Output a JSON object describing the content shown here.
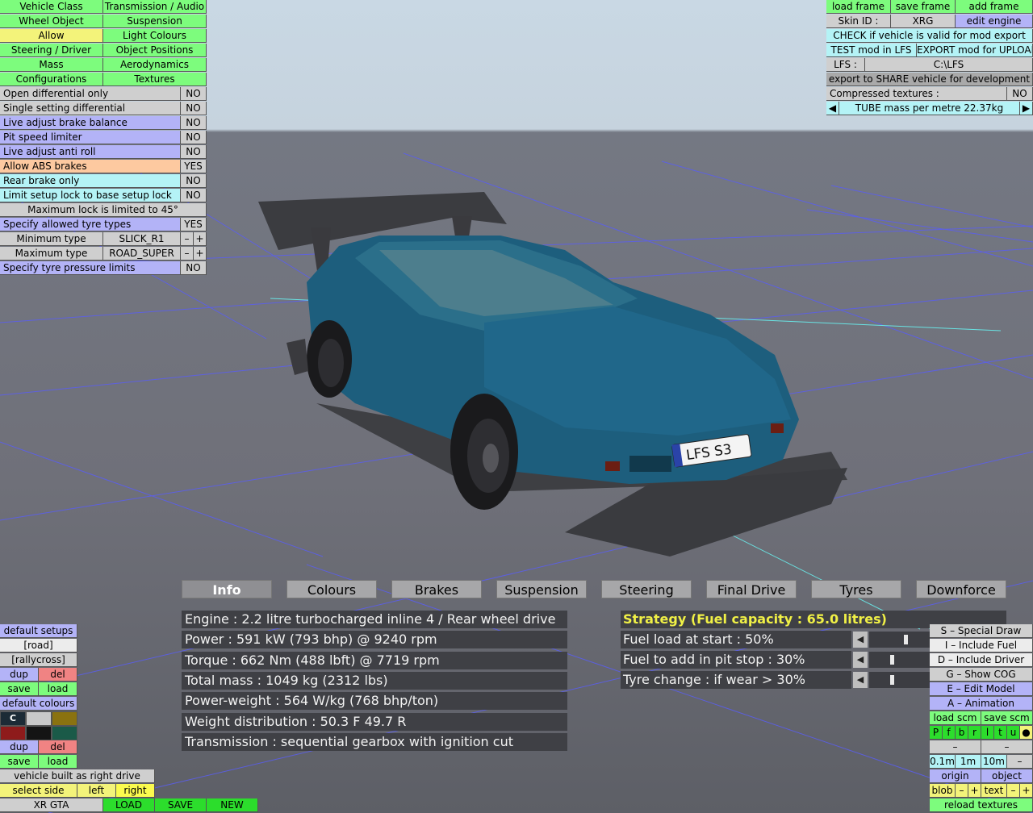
{
  "colors": {
    "accent_green": "#7dfc7d",
    "accent_yellow": "#f3f37a",
    "accent_purple": "#b3b3f7",
    "accent_cyan": "#b4f3f6",
    "car_blue": "#1d5e7d",
    "grid_line": "#5a5ef2"
  },
  "top_menu": [
    {
      "label": "Vehicle Class"
    },
    {
      "label": "Transmission / Audio"
    },
    {
      "label": "Wheel Object"
    },
    {
      "label": "Suspension"
    },
    {
      "label": "Allow"
    },
    {
      "label": "Light Colours"
    },
    {
      "label": "Steering / Driver"
    },
    {
      "label": "Object Positions"
    },
    {
      "label": "Mass"
    },
    {
      "label": "Aerodynamics"
    },
    {
      "label": "Configurations"
    },
    {
      "label": "Textures"
    }
  ],
  "allow_rows": [
    {
      "label": "Open differential only",
      "value": "NO"
    },
    {
      "label": "Single setting differential",
      "value": "NO"
    },
    {
      "label": "Live adjust brake balance",
      "value": "NO"
    },
    {
      "label": "Pit speed limiter",
      "value": "NO"
    },
    {
      "label": "Live adjust anti roll",
      "value": "NO"
    },
    {
      "label": "Allow ABS brakes",
      "value": "YES"
    },
    {
      "label": "Rear brake only",
      "value": "NO"
    },
    {
      "label": "Limit setup lock to base setup lock",
      "value": "NO"
    }
  ],
  "max_lock": "Maximum lock is limited to 45°",
  "tyre_types": {
    "label": "Specify allowed tyre types",
    "value": "YES"
  },
  "min_type": {
    "label": "Minimum type",
    "value": "SLICK_R1",
    "minus": "–",
    "plus": "+"
  },
  "max_type": {
    "label": "Maximum type",
    "value": "ROAD_SUPER",
    "minus": "–",
    "plus": "+"
  },
  "tyre_pressure": {
    "label": "Specify tyre pressure limits",
    "value": "NO"
  },
  "top_right": {
    "load_frame": "load frame",
    "save_frame": "save frame",
    "add_frame": "add frame",
    "skin_label": "Skin ID :",
    "skin_value": "XRG",
    "edit_engine": "edit engine",
    "check_valid": "CHECK if vehicle is valid for mod export",
    "test_mod": "TEST mod in LFS",
    "export_mod": "EXPORT mod for UPLOAD",
    "lfs_label": "LFS :",
    "lfs_path": "C:\\LFS",
    "export_share": "export to SHARE vehicle for development",
    "compressed_label": "Compressed textures :",
    "compressed_value": "NO",
    "tube_mass": "TUBE mass per metre 22.37kg",
    "left_arrow": "◀",
    "right_arrow": "▶"
  },
  "plate": "LFS S3",
  "tabs": [
    "Info",
    "Colours",
    "Brakes",
    "Suspension",
    "Steering",
    "Final Drive",
    "Tyres",
    "Downforce"
  ],
  "info": [
    "Engine : 2.2 litre turbocharged inline 4 / Rear wheel drive",
    "Power : 591 kW (793 bhp) @ 9240 rpm",
    "Torque : 662 Nm (488 lbft) @ 7719 rpm",
    "Total mass : 1049 kg (2312 lbs)",
    "Power-weight : 564 W/kg (768 bhp/ton)",
    "Weight distribution : 50.3 F  49.7 R",
    "Transmission : sequential gearbox with ignition cut"
  ],
  "strategy": {
    "title": "Strategy (Fuel capacity : 65.0 litres)",
    "rows": [
      {
        "label": "Fuel load at start : 50%",
        "level": 0.5
      },
      {
        "label": "Fuel to add in pit stop : 30%",
        "level": 0.3
      },
      {
        "label": "Tyre change : if wear > 30%",
        "level": 0.3
      }
    ],
    "arrow": "◀"
  },
  "bottom_left": {
    "default_setups": "default setups",
    "road": "[road]",
    "rallycross": "[rallycross]",
    "dup": "dup",
    "del": "del",
    "save": "save",
    "load": "load",
    "default_colours": "default colours",
    "c": "C",
    "swatches": [
      "#1c2b36",
      "#c9c9c9",
      "#8a7210",
      "#8e1b1b",
      "#141414",
      "#1a5a48"
    ],
    "right_drive": "vehicle built as right drive",
    "select_side": "select side",
    "left": "left",
    "right": "right",
    "xr_gta": "XR GTA",
    "load_btn": "LOAD",
    "save_btn": "SAVE",
    "new_btn": "NEW"
  },
  "bottom_right": {
    "special_draw": "S – Special Draw",
    "include_fuel": "I – Include Fuel",
    "include_driver": "D – Include Driver",
    "show_cog": "G – Show COG",
    "edit_model": "E – Edit Model",
    "animation": "A – Animation",
    "load_scm": "load scm",
    "save_scm": "save scm",
    "letters": [
      "P",
      "f",
      "b",
      "r",
      "l",
      "t",
      "u",
      "●"
    ],
    "dash1": "–",
    "dash2": "–",
    "scale": [
      "0.1m",
      "1m",
      "10m",
      "–"
    ],
    "origin": "origin",
    "object": "object",
    "blob": "blob",
    "minus": "–",
    "plus": "+",
    "text": "text",
    "reload": "reload textures"
  }
}
